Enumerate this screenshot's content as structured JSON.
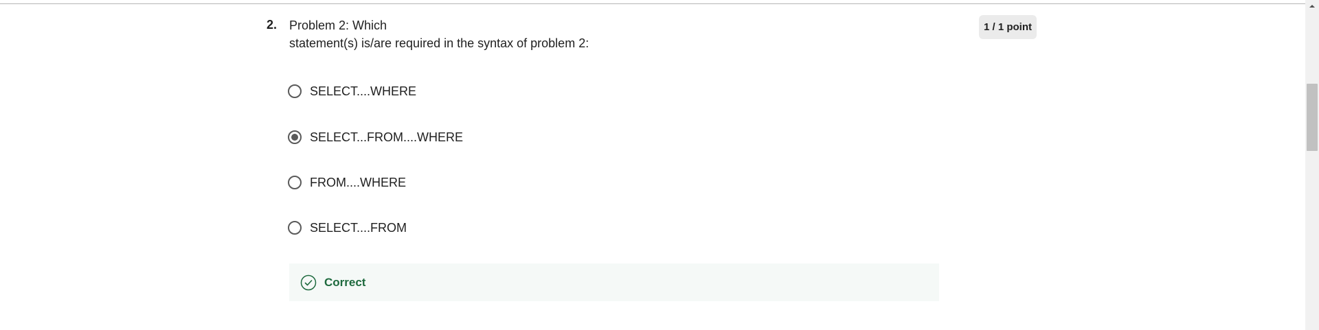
{
  "question": {
    "number": "2.",
    "text_line1": "Problem 2: Which",
    "text_line2": "statement(s) is/are required in the syntax of problem 2:",
    "points": "1 / 1 point"
  },
  "options": [
    {
      "label": "SELECT....WHERE",
      "selected": false
    },
    {
      "label": "SELECT...FROM....WHERE",
      "selected": true
    },
    {
      "label": "FROM....WHERE",
      "selected": false
    },
    {
      "label": "SELECT....FROM",
      "selected": false
    }
  ],
  "feedback": {
    "label": "Correct",
    "icon": "check-circle-icon",
    "color": "#1e6a3e"
  },
  "colors": {
    "radio": "#5a5a5a",
    "badge_bg": "#ebebeb",
    "feedback_bg": "#f5f9f7"
  }
}
